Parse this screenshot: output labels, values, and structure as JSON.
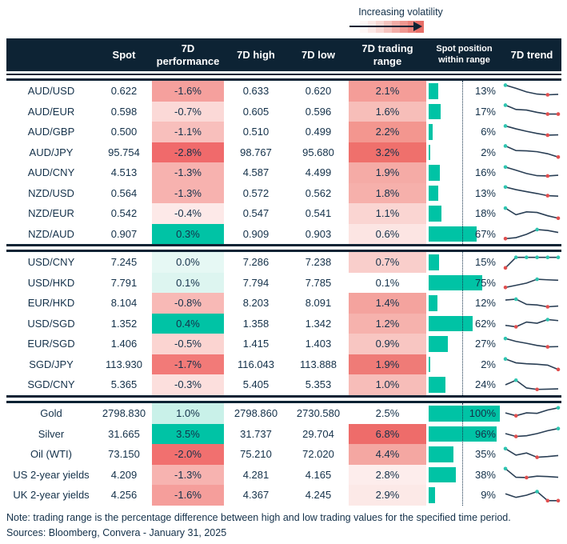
{
  "legend": {
    "label": "Increasing volatility",
    "gradient": [
      "#fef7f6",
      "#fce9e7",
      "#f9d8d4",
      "#f5c3be",
      "#f2aca6",
      "#ef968f",
      "#eb827b",
      "#e76e67"
    ]
  },
  "colors": {
    "navy": "#0d2334",
    "text": "#14314a",
    "teal": "#00c3a5",
    "bar": "#00c3a5",
    "spark_line": "#2a3f55",
    "spark_hi": "#2fc5b0",
    "spark_lo": "#e04f4f"
  },
  "chart_data": {
    "type": "table",
    "columns": [
      {
        "label": ""
      },
      {
        "label": "Spot"
      },
      {
        "label": "7D performance"
      },
      {
        "label": "7D high"
      },
      {
        "label": "7D low"
      },
      {
        "label": "7D trading range"
      },
      {
        "label": "Spot position within range"
      },
      {
        "label": "7D trend"
      }
    ],
    "bar_scale_note": "bars scaled 0-100% of range; dotted line marks 50%",
    "sections": [
      {
        "rows": [
          {
            "label": "AUD/USD",
            "spot": "0.622",
            "perf": "-1.6%",
            "perf_bg": "#f5a09d",
            "high": "0.633",
            "low": "0.620",
            "range": "2.1%",
            "range_bg": "#f49d98",
            "pos": 13,
            "pos_label": "13%",
            "spark": {
              "y": [
                0.92,
                0.7,
                0.45,
                0.3,
                0.25,
                0.28
              ],
              "hi": [
                0
              ],
              "lo": [
                4
              ]
            }
          },
          {
            "label": "AUD/EUR",
            "spot": "0.598",
            "perf": "-0.7%",
            "perf_bg": "#fbd9d7",
            "high": "0.605",
            "low": "0.596",
            "range": "1.6%",
            "range_bg": "#f7beb9",
            "pos": 17,
            "pos_label": "17%",
            "spark": {
              "y": [
                0.92,
                0.62,
                0.58,
                0.42,
                0.3,
                0.3
              ],
              "hi": [
                0
              ],
              "lo": [
                4,
                5
              ]
            }
          },
          {
            "label": "AUD/GBP",
            "spot": "0.500",
            "perf": "-1.1%",
            "perf_bg": "#f8bfbc",
            "high": "0.510",
            "low": "0.499",
            "range": "2.2%",
            "range_bg": "#f3968f",
            "pos": 6,
            "pos_label": "6%",
            "spark": {
              "y": [
                0.92,
                0.72,
                0.55,
                0.4,
                0.28,
                0.3
              ],
              "hi": [
                0
              ],
              "lo": [
                4
              ]
            }
          },
          {
            "label": "AUD/JPY",
            "spot": "95.754",
            "perf": "-2.8%",
            "perf_bg": "#f06a6b",
            "high": "98.767",
            "low": "95.680",
            "range": "3.2%",
            "range_bg": "#ef706c",
            "pos": 2,
            "pos_label": "2%",
            "spark": {
              "y": [
                0.92,
                0.6,
                0.58,
                0.52,
                0.38,
                0.15
              ],
              "hi": [
                0
              ],
              "lo": [
                5
              ]
            }
          },
          {
            "label": "AUD/CNY",
            "spot": "4.513",
            "perf": "-1.3%",
            "perf_bg": "#f7b2af",
            "high": "4.587",
            "low": "4.499",
            "range": "1.9%",
            "range_bg": "#f5aba6",
            "pos": 16,
            "pos_label": "16%",
            "spark": {
              "y": [
                0.9,
                0.68,
                0.45,
                0.3,
                0.28,
                0.33
              ],
              "hi": [
                0
              ],
              "lo": [
                4
              ]
            }
          },
          {
            "label": "NZD/USD",
            "spot": "0.564",
            "perf": "-1.3%",
            "perf_bg": "#f7b2af",
            "high": "0.572",
            "low": "0.562",
            "range": "1.8%",
            "range_bg": "#f6b0ab",
            "pos": 13,
            "pos_label": "13%",
            "spark": {
              "y": [
                0.9,
                0.72,
                0.58,
                0.45,
                0.3,
                0.27
              ],
              "hi": [
                0
              ],
              "lo": [
                4
              ]
            }
          },
          {
            "label": "NZD/EUR",
            "spot": "0.542",
            "perf": "-0.4%",
            "perf_bg": "#fde9e8",
            "high": "0.547",
            "low": "0.541",
            "range": "1.1%",
            "range_bg": "#fad5d2",
            "pos": 18,
            "pos_label": "18%",
            "spark": {
              "y": [
                0.88,
                0.42,
                0.62,
                0.58,
                0.35,
                0.18
              ],
              "hi": [
                0
              ],
              "lo": [
                5
              ]
            }
          },
          {
            "label": "NZD/AUD",
            "spot": "0.907",
            "perf": "0.3%",
            "perf_bg": "#00c3a5",
            "high": "0.909",
            "low": "0.903",
            "range": "0.6%",
            "range_bg": "#fce5e3",
            "pos": 67,
            "pos_label": "67%",
            "spark": {
              "y": [
                0.15,
                0.22,
                0.45,
                0.78,
                0.72,
                0.58
              ],
              "hi": [
                3
              ],
              "lo": [
                0
              ]
            }
          }
        ]
      },
      {
        "rows": [
          {
            "label": "USD/CNY",
            "spot": "7.245",
            "perf": "0.0%",
            "perf_bg": "#e6f8f4",
            "high": "7.286",
            "low": "7.238",
            "range": "0.7%",
            "range_bg": "#f9cecb",
            "pos": 15,
            "pos_label": "15%",
            "spark": {
              "y": [
                0.12,
                0.85,
                0.85,
                0.85,
                0.85,
                0.85
              ],
              "hi": [
                1,
                2,
                3,
                4,
                5
              ],
              "lo": [
                0
              ]
            }
          },
          {
            "label": "USD/HKD",
            "spot": "7.791",
            "perf": "0.1%",
            "perf_bg": "#ddf5f0",
            "high": "7.794",
            "low": "7.785",
            "range": "0.1%",
            "range_bg": "#ffffff",
            "pos": 75,
            "pos_label": "75%",
            "spark": {
              "y": [
                0.15,
                0.3,
                0.45,
                0.72,
                0.68,
                0.65
              ],
              "hi": [
                3
              ],
              "lo": [
                0
              ]
            }
          },
          {
            "label": "EUR/HKD",
            "spot": "8.104",
            "perf": "-0.8%",
            "perf_bg": "#f8b9b6",
            "high": "8.203",
            "low": "8.091",
            "range": "1.4%",
            "range_bg": "#f4a39e",
            "pos": 12,
            "pos_label": "12%",
            "spark": {
              "y": [
                0.72,
                0.78,
                0.42,
                0.38,
                0.25,
                0.3
              ],
              "hi": [
                1
              ],
              "lo": [
                4
              ]
            }
          },
          {
            "label": "USD/SGD",
            "spot": "1.352",
            "perf": "0.4%",
            "perf_bg": "#00c3a5",
            "high": "1.358",
            "low": "1.342",
            "range": "1.2%",
            "range_bg": "#f6b2ad",
            "pos": 62,
            "pos_label": "62%",
            "spark": {
              "y": [
                0.35,
                0.25,
                0.58,
                0.5,
                0.75,
                0.68
              ],
              "hi": [
                4
              ],
              "lo": [
                1
              ]
            }
          },
          {
            "label": "EUR/SGD",
            "spot": "1.406",
            "perf": "-0.5%",
            "perf_bg": "#fbd4d1",
            "high": "1.415",
            "low": "1.403",
            "range": "0.9%",
            "range_bg": "#f8c6c2",
            "pos": 27,
            "pos_label": "27%",
            "spark": {
              "y": [
                0.88,
                0.68,
                0.55,
                0.4,
                0.3,
                0.32
              ],
              "hi": [
                0
              ],
              "lo": [
                4
              ]
            }
          },
          {
            "label": "SGD/JPY",
            "spot": "113.930",
            "perf": "-1.7%",
            "perf_bg": "#f27a78",
            "high": "116.043",
            "low": "113.888",
            "range": "1.9%",
            "range_bg": "#ef7b77",
            "pos": 2,
            "pos_label": "2%",
            "spark": {
              "y": [
                0.85,
                0.58,
                0.52,
                0.48,
                0.42,
                0.12
              ],
              "hi": [
                0
              ],
              "lo": [
                5
              ]
            }
          },
          {
            "label": "SGD/CNY",
            "spot": "5.365",
            "perf": "-0.3%",
            "perf_bg": "#fcdfdd",
            "high": "5.405",
            "low": "5.353",
            "range": "1.0%",
            "range_bg": "#f7bdb9",
            "pos": 24,
            "pos_label": "24%",
            "spark": {
              "y": [
                0.5,
                0.82,
                0.28,
                0.18,
                0.2,
                0.22
              ],
              "hi": [
                1
              ],
              "lo": [
                3
              ]
            }
          }
        ]
      },
      {
        "rows": [
          {
            "label": "Gold",
            "spot": "2798.830",
            "perf": "1.0%",
            "perf_bg": "#c9f1e9",
            "high": "2798.860",
            "low": "2730.580",
            "range": "2.5%",
            "range_bg": "#ffffff",
            "pos": 100,
            "pos_label": "100%",
            "spark": {
              "y": [
                0.55,
                0.35,
                0.55,
                0.52,
                0.75,
                0.9
              ],
              "hi": [
                5
              ],
              "lo": [
                1
              ]
            }
          },
          {
            "label": "Silver",
            "spot": "31.665",
            "perf": "3.5%",
            "perf_bg": "#00c3a5",
            "high": "31.737",
            "low": "29.704",
            "range": "6.8%",
            "range_bg": "#ee6c6a",
            "pos": 96,
            "pos_label": "96%",
            "spark": {
              "y": [
                0.5,
                0.3,
                0.35,
                0.5,
                0.7,
                0.85
              ],
              "hi": [
                5
              ],
              "lo": [
                1
              ]
            }
          },
          {
            "label": "Oil (WTI)",
            "spot": "73.150",
            "perf": "-2.0%",
            "perf_bg": "#f1706f",
            "high": "75.210",
            "low": "72.020",
            "range": "4.4%",
            "range_bg": "#f4a7a2",
            "pos": 35,
            "pos_label": "35%",
            "spark": {
              "y": [
                0.9,
                0.45,
                0.6,
                0.3,
                0.35,
                0.42
              ],
              "hi": [
                0
              ],
              "lo": [
                3
              ]
            }
          },
          {
            "label": "US 2-year yields",
            "spot": "4.209",
            "perf": "-1.3%",
            "perf_bg": "#f7b3b0",
            "high": "4.281",
            "low": "4.165",
            "range": "2.8%",
            "range_bg": "#fdedec",
            "pos": 38,
            "pos_label": "38%",
            "spark": {
              "y": [
                0.9,
                0.3,
                0.28,
                0.38,
                0.35,
                0.3
              ],
              "hi": [
                0
              ],
              "lo": [
                2
              ]
            }
          },
          {
            "label": "UK 2-year yields",
            "spot": "4.256",
            "perf": "-1.6%",
            "perf_bg": "#f59e9b",
            "high": "4.367",
            "low": "4.245",
            "range": "2.9%",
            "range_bg": "#fce9e7",
            "pos": 9,
            "pos_label": "9%",
            "spark": {
              "y": [
                0.6,
                0.35,
                0.5,
                0.75,
                0.12,
                0.12
              ],
              "hi": [
                3
              ],
              "lo": [
                4,
                5
              ]
            }
          }
        ]
      }
    ]
  },
  "footer": {
    "note": "Note: trading range is the percentage difference between high and low trading values for the specified time period.",
    "sources": "Sources: Bloomberg, Convera - January 31, 2025"
  }
}
